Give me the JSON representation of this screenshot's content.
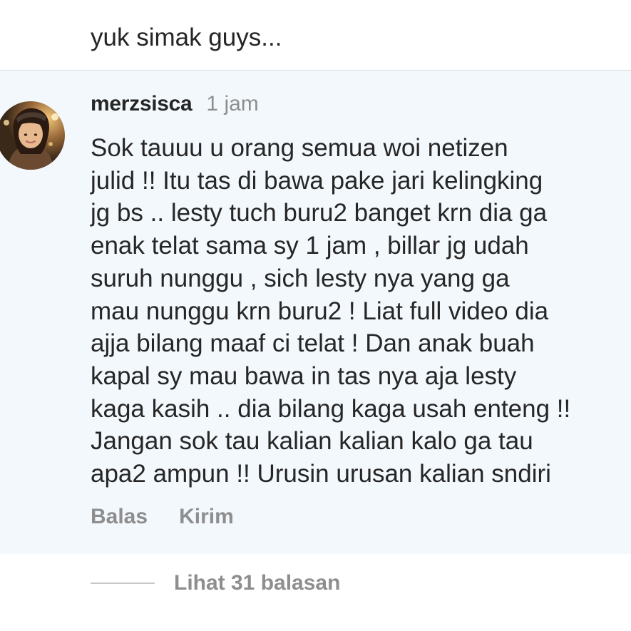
{
  "previous_comment": {
    "text": "yuk simak guys..."
  },
  "comment": {
    "username": "merzsisca",
    "timestamp": "1 jam",
    "body_lines": [
      "Sok tauuu u orang semua woi netizen",
      "julid !! Itu tas di bawa pake jari kelingking",
      "jg bs .. lesty tuch buru2 banget krn dia ga",
      "enak telat sama sy 1 jam , billar jg udah",
      "suruh nunggu , sich lesty nya yang ga",
      "mau nunggu krn buru2 ! Liat full video dia",
      "ajja bilang maaf ci telat ! Dan anak buah",
      "kapal sy mau bawa in tas nya aja lesty",
      "kaga kasih .. dia bilang kaga usah enteng !!",
      "Jangan sok tau kalian kalian kalo ga tau",
      "apa2 ampun !! Urusin urusan kalian sndiri"
    ],
    "actions": {
      "reply_label": "Balas",
      "send_label": "Kirim"
    },
    "avatar_icon": "user-avatar-photo"
  },
  "replies": {
    "label": "Lihat 31 balasan"
  },
  "colors": {
    "highlight_background": "#f3f8fd",
    "primary_text": "#262626",
    "secondary_text": "#8e8e8e",
    "divider": "#dcdcdc"
  }
}
